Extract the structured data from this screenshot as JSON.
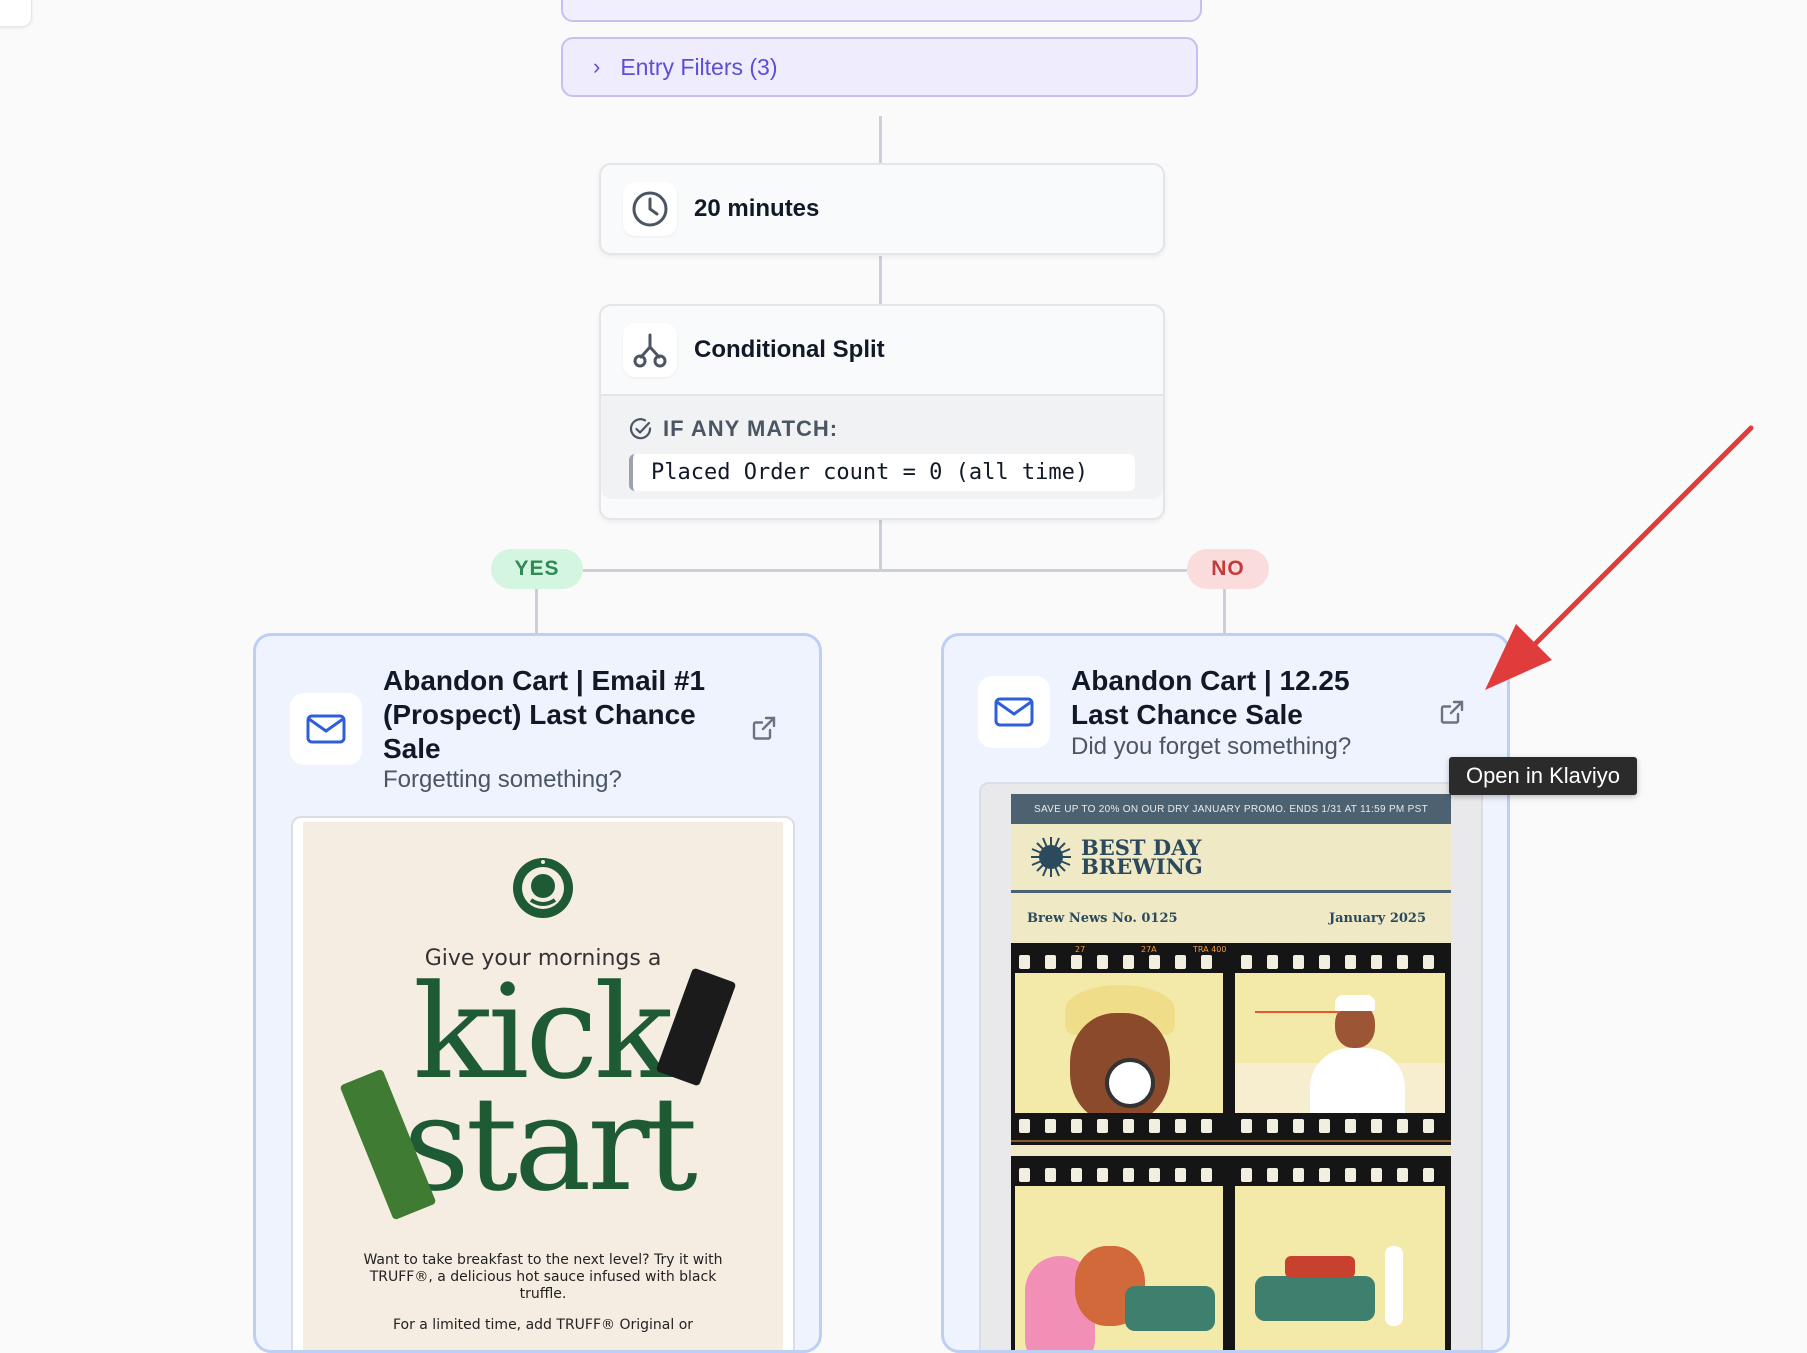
{
  "flow": {
    "entry_filters_label": "Entry Filters (3)",
    "delay_label": "20 minutes",
    "split": {
      "title": "Conditional Split",
      "match_label": "IF ANY MATCH:",
      "condition": "Placed Order count = 0 (all time)"
    },
    "yes_label": "YES",
    "no_label": "NO"
  },
  "yes_email": {
    "title_line1": "Abandon Cart | Email #1",
    "title_line2": "(Prospect) Last Chance",
    "title_line3": "Sale",
    "subject": "Forgetting something?",
    "preview": {
      "tagline": "Give your mornings a",
      "headline_1": "kick",
      "headline_2": "start",
      "copy": "Want to take breakfast to the next level? Try it with TRUFF®, a delicious hot sauce infused with black truffle.",
      "copy_2": "For a limited time, add TRUFF® Original or"
    }
  },
  "no_email": {
    "title_line1": "Abandon Cart | 12.25",
    "title_line2": "Last Chance Sale",
    "subject": "Did you forget something?",
    "preview": {
      "banner": "SAVE UP TO 20% ON OUR DRY JANUARY PROMO. ENDS 1/31 AT 11:59 PM PST",
      "brand_line1": "BEST DAY",
      "brand_line2": "BREWING",
      "issue": "Brew News No. 0125",
      "date": "January 2025",
      "film_label_a": "27",
      "film_label_b": "27A",
      "film_label_c": "TRA 400"
    }
  },
  "tooltip": "Open in Klaviyo",
  "colors": {
    "accent_purple": "#5b4fd6",
    "email_border": "#bcd0f5",
    "yes_green": "#2f8a55",
    "no_red": "#c53b3b",
    "annotation_arrow": "#e03c3c"
  }
}
